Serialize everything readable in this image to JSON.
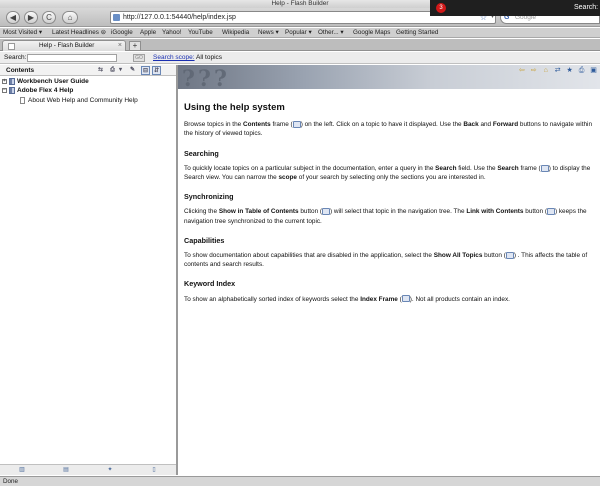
{
  "window": {
    "title": "Help - Flash Builder"
  },
  "notification": {
    "badge": "3",
    "text": "Search: fle"
  },
  "nav": {
    "back_glyph": "◀",
    "forward_glyph": "▶",
    "reload_glyph": "C",
    "home_glyph": "⌂",
    "url": "http://127.0.0.1:54440/help/index.jsp",
    "search_placeholder": "Google"
  },
  "bookmarks": [
    {
      "label": "Most Visited ▾"
    },
    {
      "label": "Latest Headlines ⊜"
    },
    {
      "label": "iGoogle"
    },
    {
      "label": "Apple"
    },
    {
      "label": "Yahoo!"
    },
    {
      "label": "YouTube"
    },
    {
      "label": "Wikipedia"
    },
    {
      "label": "News ▾"
    },
    {
      "label": "Popular ▾"
    },
    {
      "label": "Other... ▾"
    },
    {
      "label": "Google Maps"
    },
    {
      "label": "Getting Started"
    }
  ],
  "tab": {
    "label": "Help - Flash Builder",
    "new_tab": "+"
  },
  "help_search": {
    "label": "Search:",
    "go": "GO",
    "scope_link": "Search scope:",
    "scope_value": "All topics"
  },
  "contents": {
    "title": "Contents",
    "tree": [
      {
        "label": "Workbench User Guide",
        "toggle": "+"
      },
      {
        "label": "Adobe Flex 4 Help",
        "toggle": "−"
      },
      {
        "label": "About Web Help and Community Help"
      }
    ]
  },
  "article": {
    "title": "Using the help system",
    "intro": {
      "a": "Browse topics in the ",
      "b": "Contents",
      "c": " frame (",
      "d": ") on the left. Click on a topic to have it displayed. Use the ",
      "e": "Back",
      "f": " and ",
      "g": "Forward",
      "h": " buttons to navigate within the history of viewed topics."
    },
    "searching": {
      "heading": "Searching",
      "a": "To quickly locate topics on a particular subject in the documentation, enter a query in the ",
      "b": "Search",
      "c": " field. Use the ",
      "d": "Search",
      "e": " frame (",
      "f": ") to display the Search view. You can narrow the ",
      "g": "scope",
      "h": " of your search by selecting only the sections you are interested in."
    },
    "sync": {
      "heading": "Synchronizing",
      "a": "Clicking the ",
      "b": "Show in Table of Contents",
      "c": " button (",
      "d": ") will select that topic in the navigation tree. The ",
      "e": "Link with Contents",
      "f": " button (",
      "g": ") keeps the navigation tree synchronized to the current topic."
    },
    "caps": {
      "heading": "Capabilities",
      "a": "To show documentation about capabilities that are disabled in the application, select the ",
      "b": "Show All Topics",
      "c": " button (",
      "d": ") . This affects the table of contents and search results."
    },
    "keyword": {
      "heading": "Keyword Index",
      "a": "To show an alphabetically sorted index of keywords select the ",
      "b": "Index Frame",
      "c": " (",
      "d": "). Not all products contain an index."
    }
  },
  "status": {
    "text": "Done"
  }
}
